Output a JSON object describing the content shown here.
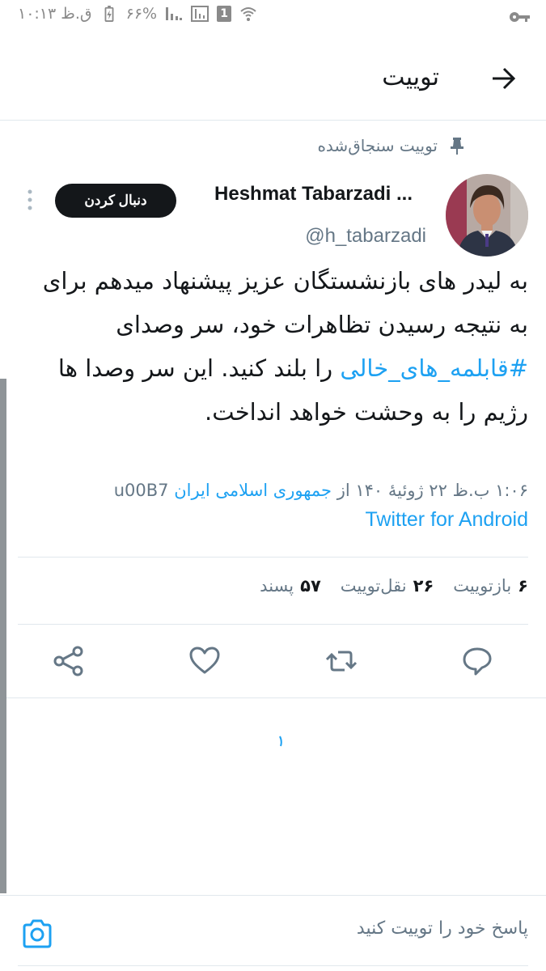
{
  "status_bar": {
    "time": "۱۰:۱۳ ق.ظ",
    "battery": "۶۶%"
  },
  "header": {
    "title": "توییت"
  },
  "pinned_label": "توییت سنجاق‌شده",
  "author": {
    "name": "Heshmat Tabarzadi ...",
    "handle": "@h_tabarzadi",
    "follow_label": "دنبال کردن"
  },
  "tweet": {
    "text_before": "به لیدر های  بازنشستگان عزیز پیشنهاد میدهم برای به نتیجه رسیدن تظاهرات خود، سر وصدای ",
    "hashtag": "#قابلمه_های_خالی",
    "text_after": " را بلند کنید. این سر وصدا ها رژیم را به وحشت خواهد انداخت.",
    "time_date": "۱:۰۶ ب.ظ ۲۲ ژوئیهٔ ۱۴۰ از ",
    "location": "جمهوری اسلامی ایران",
    "separator": " u00B7",
    "source": "Twitter for Android"
  },
  "stats": {
    "replies_count": "۶",
    "replies_label": "بازتوییت",
    "retweets_count": "۲۶",
    "retweets_label": "نقل‌توییت",
    "likes_count": "۵۷",
    "likes_label": "پسند"
  },
  "reply": {
    "placeholder": "پاسخ خود را توییت کنید"
  },
  "colors": {
    "accent": "#1da1f2",
    "text": "#14171a",
    "muted": "#657786",
    "divider": "#e1e8ed"
  }
}
